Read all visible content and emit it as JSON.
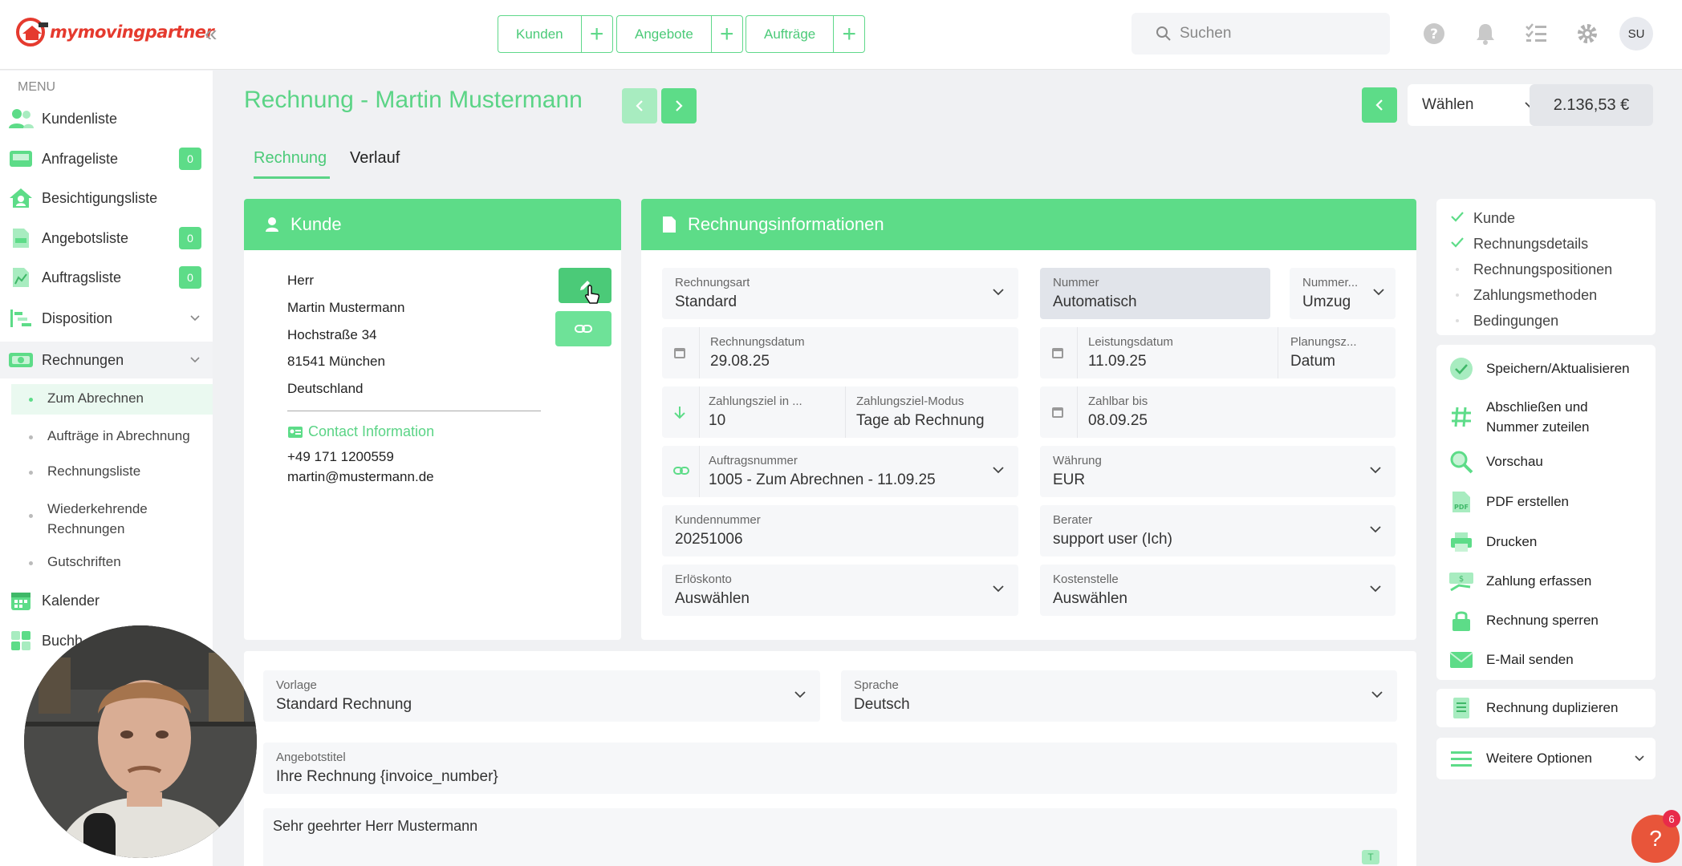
{
  "brand": {
    "name": "mymovingpartner"
  },
  "topnav": [
    {
      "label": "Kunden"
    },
    {
      "label": "Angebote"
    },
    {
      "label": "Aufträge"
    }
  ],
  "search": {
    "placeholder": "Suchen"
  },
  "user": {
    "initials": "SU"
  },
  "sidebar": {
    "menu_title": "MENU",
    "items": [
      {
        "label": "Kundenliste"
      },
      {
        "label": "Anfrageliste",
        "badge": "0"
      },
      {
        "label": "Besichtigungsliste"
      },
      {
        "label": "Angebotsliste",
        "badge": "0"
      },
      {
        "label": "Auftragsliste",
        "badge": "0"
      },
      {
        "label": "Disposition"
      },
      {
        "label": "Rechnungen"
      },
      {
        "label": "Kalender"
      },
      {
        "label": "Buchh"
      }
    ],
    "sub_items": [
      {
        "label": "Zum Abrechnen"
      },
      {
        "label": "Aufträge in Abrechnung"
      },
      {
        "label": "Rechnungsliste"
      },
      {
        "label": "Wiederkehrende Rechnungen"
      },
      {
        "label": "Gutschriften"
      }
    ]
  },
  "page": {
    "title": "Rechnung - Martin Mustermann",
    "tabs": [
      {
        "label": "Rechnung"
      },
      {
        "label": "Verlauf"
      }
    ],
    "select_label": "Wählen",
    "total": "2.136,53 €"
  },
  "kunde": {
    "title": "Kunde",
    "salutation": "Herr",
    "name": "Martin Mustermann",
    "street": "Hochstraße 34",
    "city": "81541 München",
    "country": "Deutschland",
    "contact_title": "Contact Information",
    "phone": "+49 171 1200559",
    "email": "martin@mustermann.de"
  },
  "rechnung": {
    "title": "Rechnungsinformationen",
    "rechnungsart": {
      "label": "Rechnungsart",
      "value": "Standard"
    },
    "nummer": {
      "label": "Nummer",
      "value": "Automatisch"
    },
    "nummernkreis": {
      "label": "Nummer...",
      "value": "Umzug"
    },
    "rechnungsdatum": {
      "label": "Rechnungsdatum",
      "value": "29.08.25"
    },
    "leistungsdatum": {
      "label": "Leistungsdatum",
      "value": "11.09.25"
    },
    "planung": {
      "label": "Planungsz...",
      "value": "Datum"
    },
    "zahlungsziel": {
      "label": "Zahlungsziel in ...",
      "value": "10"
    },
    "zahlungsziel_modus": {
      "label": "Zahlungsziel-Modus",
      "value": "Tage ab Rechnung"
    },
    "zahlbar_bis": {
      "label": "Zahlbar bis",
      "value": "08.09.25"
    },
    "auftragsnummer": {
      "label": "Auftragsnummer",
      "value": "1005 - Zum Abrechnen - 11.09.25"
    },
    "waehrung": {
      "label": "Währung",
      "value": "EUR"
    },
    "kundennummer": {
      "label": "Kundennummer",
      "value": "20251006"
    },
    "berater": {
      "label": "Berater",
      "value": "support user (Ich)"
    },
    "erloeskonto": {
      "label": "Erlöskonto",
      "value": "Auswählen"
    },
    "kostenstelle": {
      "label": "Kostenstelle",
      "value": "Auswählen"
    }
  },
  "lower": {
    "vorlage": {
      "label": "Vorlage",
      "value": "Standard Rechnung"
    },
    "sprache": {
      "label": "Sprache",
      "value": "Deutsch"
    },
    "angebotstitel": {
      "label": "Angebotstitel",
      "value": "Ihre Rechnung {invoice_number}"
    },
    "anrede": "Sehr geehrter Herr Mustermann"
  },
  "steps": [
    {
      "label": "Kunde",
      "done": true
    },
    {
      "label": "Rechnungsdetails",
      "done": true
    },
    {
      "label": "Rechnungspositionen",
      "done": false
    },
    {
      "label": "Zahlungsmethoden",
      "done": false
    },
    {
      "label": "Bedingungen",
      "done": false
    }
  ],
  "actions": [
    {
      "label": "Speichern/Aktualisieren"
    },
    {
      "label": "Abschließen und Nummer zuteilen"
    },
    {
      "label": "Vorschau"
    },
    {
      "label": "PDF erstellen"
    },
    {
      "label": "Drucken"
    },
    {
      "label": "Zahlung erfassen"
    },
    {
      "label": "Rechnung sperren"
    },
    {
      "label": "E-Mail senden"
    }
  ],
  "duplicate_label": "Rechnung duplizieren",
  "more_options_label": "Weitere Optionen",
  "help": {
    "icon": "?",
    "badge": "6"
  },
  "colors": {
    "accent": "#5ddc88",
    "accent_text": "#4bca78",
    "brand_red": "#e53a2e"
  }
}
